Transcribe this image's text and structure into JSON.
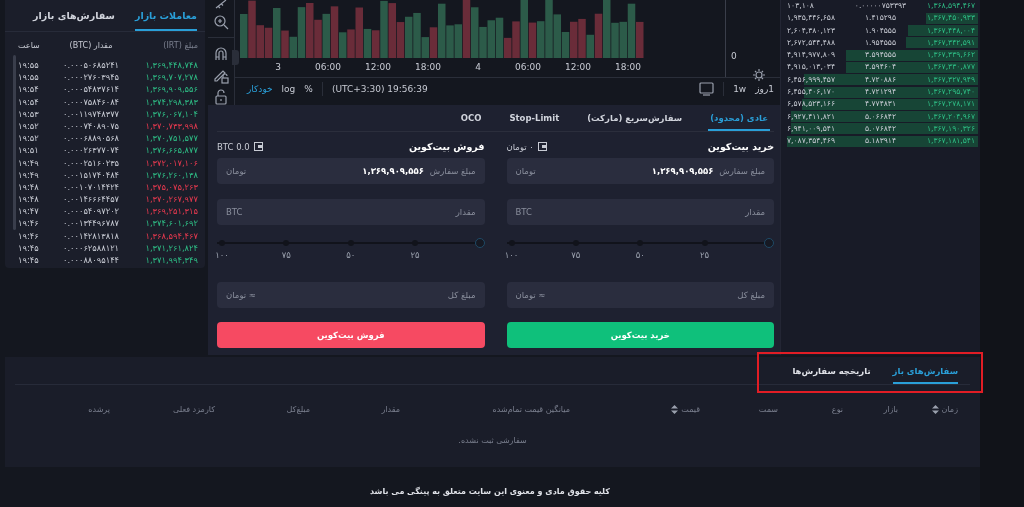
{
  "market_trades": {
    "tabs": [
      {
        "label": "معاملات بازار",
        "selected": true
      },
      {
        "label": "سفارش‌های بازار",
        "selected": false
      }
    ],
    "columns": [
      "مبلغ (IRT)",
      "مقدار (BTC)",
      "ساعت"
    ],
    "rows": [
      {
        "price": "۱,۳۶۹,۴۴۸,۷۴۸",
        "amount": "۰.۰۰۰۵۰۶۸۵۲۴۱",
        "time": "۱۹:۵۵",
        "kind": "buy"
      },
      {
        "price": "۱,۳۶۹,۷۰۷,۲۷۸",
        "amount": "۰.۰۰۰۲۷۶۰۳۹۴۵",
        "time": "۱۹:۵۵",
        "kind": "buy"
      },
      {
        "price": "۱,۳۶۹,۹۰۹,۵۵۶",
        "amount": "۰.۰۰۰۵۴۸۳۷۶۱۴",
        "time": "۱۹:۵۴",
        "kind": "buy"
      },
      {
        "price": "۱,۳۷۴,۲۹۸,۳۸۳",
        "amount": "۰.۰۰۰۷۵۸۴۶۰۸۴",
        "time": "۱۹:۵۴",
        "kind": "buy"
      },
      {
        "price": "۱,۳۷۶,۰۶۷,۱۰۴",
        "amount": "۰.۰۰۱۱۹۷۴۸۳۷۷",
        "time": "۱۹:۵۳",
        "kind": "buy"
      },
      {
        "price": "۱,۳۷۰,۷۳۳,۹۹۸",
        "amount": "۰.۰۰۰۷۴۰۸۹۰۷۵",
        "time": "۱۹:۵۲",
        "kind": "sell"
      },
      {
        "price": "۱,۳۷۰,۷۵۱,۵۷۷",
        "amount": "۰.۰۰۰۶۸۸۹۰۵۶۸",
        "time": "۱۹:۵۲",
        "kind": "buy"
      },
      {
        "price": "۱,۳۷۶,۶۶۵,۸۷۷",
        "amount": "۰.۰۰۰۲۶۳۷۷۰۷۴",
        "time": "۱۹:۵۱",
        "kind": "buy"
      },
      {
        "price": "۱,۳۷۲,۰۱۷,۱۰۶",
        "amount": "۰.۰۰۰۲۵۱۶۰۲۳۵",
        "time": "۱۹:۴۹",
        "kind": "sell"
      },
      {
        "price": "۱,۳۷۶,۲۶۰,۱۳۸",
        "amount": "۰.۰۰۱۵۱۷۴۰۴۸۴",
        "time": "۱۹:۴۹",
        "kind": "buy"
      },
      {
        "price": "۱,۳۷۵,۰۷۵,۲۶۳",
        "amount": "۰.۰۰۱۰۷۰۱۴۴۲۴",
        "time": "۱۹:۴۸",
        "kind": "sell"
      },
      {
        "price": "۱,۳۷۰,۲۶۷,۹۷۷",
        "amount": "۰.۰۰۱۴۶۶۶۴۴۵۷",
        "time": "۱۹:۴۸",
        "kind": "sell"
      },
      {
        "price": "۱,۳۶۹,۲۵۱,۳۱۵",
        "amount": "۰.۰۰۰۵۴۰۹۷۲۰۲",
        "time": "۱۹:۴۷",
        "kind": "sell"
      },
      {
        "price": "۱,۳۷۴,۶۰۱,۶۹۲",
        "amount": "۰.۰۰۱۳۴۴۹۶۷۸۷",
        "time": "۱۹:۴۶",
        "kind": "buy"
      },
      {
        "price": "۱,۳۶۸,۵۹۴,۴۶۷",
        "amount": "۰.۰۰۱۴۲۸۱۳۸۱۸",
        "time": "۱۹:۴۶",
        "kind": "sell"
      },
      {
        "price": "۱,۳۷۱,۲۶۱,۸۲۴",
        "amount": "۰.۰۰۰۶۲۵۸۸۱۲۱",
        "time": "۱۹:۴۵",
        "kind": "buy"
      },
      {
        "price": "۱,۳۷۱,۹۹۴,۳۴۹",
        "amount": "۰.۰۰۰۸۸۰۹۵۱۴۴",
        "time": "۱۹:۴۵",
        "kind": "buy"
      }
    ]
  },
  "chart": {
    "time_labels": [
      "18:00",
      "12:00",
      "06:00",
      "4",
      "18:00",
      "12:00",
      "06:00",
      "3"
    ],
    "axis_label": "0",
    "toolbar": {
      "auto": "خودکار",
      "log": "log",
      "percent": "%",
      "clock": "(UTC+3:30) 19:56:39",
      "intervals": [
        "1روز",
        "1w"
      ]
    }
  },
  "order_form": {
    "tabs": [
      {
        "label": "عادی (محدود)",
        "selected": true
      },
      {
        "label": "سفارش‌سریع (مارکت)",
        "selected": false
      },
      {
        "label": "Stop-Limit",
        "selected": false
      },
      {
        "label": "OCO",
        "selected": false
      }
    ],
    "panels": [
      {
        "kind": "buy",
        "title": "خرید بیت‌کوین",
        "balance": "۰ تومان",
        "price_label": "مبلغ سفارش",
        "price": "۱,۳۶۹,۹۰۹,۵۵۶",
        "price_unit": "تومان",
        "amount_placeholder": "مقدار",
        "amount_unit": "BTC",
        "slider_labels": [
          "۲۵",
          "۵۰",
          "۷۵",
          "۱۰۰"
        ],
        "total_placeholder": "مبلغ کل",
        "total_unit": "≈ تومان",
        "button": "خرید بیت‌کوین"
      },
      {
        "kind": "sell",
        "title": "فروش بیت‌کوین",
        "balance": "BTC 0.0",
        "price_label": "مبلغ سفارش",
        "price": "۱,۳۶۹,۹۰۹,۵۵۶",
        "price_unit": "تومان",
        "amount_placeholder": "مقدار",
        "amount_unit": "BTC",
        "slider_labels": [
          "۲۵",
          "۵۰",
          "۷۵",
          "۱۰۰"
        ],
        "total_placeholder": "مبلغ کل",
        "total_unit": "≈ تومان",
        "button": "فروش بیت‌کوین"
      }
    ]
  },
  "order_book": {
    "rows": [
      {
        "total": "۱۰۳,۱۰۸",
        "amount": "۰.۰۰۰۰۰۷۵۳۳۹۳",
        "price": "۱,۳۶۸,۵۹۴,۴۶۷"
      },
      {
        "total": "۱,۹۳۵,۴۴۶,۶۵۸",
        "amount": "۱.۴۱۵۲۹۵",
        "price": "۱,۳۶۷,۴۵۰,۹۳۳"
      },
      {
        "total": "۲,۶۰۴,۳۸۰,۱۲۳",
        "amount": "۱.۹۰۴۵۵۵",
        "price": "۱,۳۶۷,۴۴۸,۰۰۴"
      },
      {
        "total": "۲,۶۷۲,۵۴۴,۴۸۸",
        "amount": "۱.۹۵۴۵۵۵",
        "price": "۱,۳۶۷,۳۴۲,۵۹۱"
      },
      {
        "total": "۴,۹۱۴,۹۷۷,۸۰۹",
        "amount": "۳.۵۹۴۵۵۵",
        "price": "۱,۳۶۷,۳۳۹,۶۶۲"
      },
      {
        "total": "۴,۹۱۵,۰۱۳,۰۳۴",
        "amount": "۳.۵۹۴۶۰۴",
        "price": "۱,۳۶۷,۳۳۰,۸۷۷"
      },
      {
        "total": "۶,۴۵۶,۹۹۹,۴۵۷",
        "amount": "۴.۷۲۰۸۸۶",
        "price": "۱,۳۶۷,۳۲۷,۹۴۹"
      },
      {
        "total": "۶,۴۵۵,۴۰۶,۱۷۰",
        "amount": "۴.۷۲۱۲۹۴",
        "price": "۱,۳۶۷,۲۹۵,۷۴۰"
      },
      {
        "total": "۶,۵۷۸,۵۲۳,۱۶۶",
        "amount": "۴.۷۷۴۸۳۱",
        "price": "۱,۳۶۷,۲۷۸,۱۷۱"
      },
      {
        "total": "۶,۹۲۷,۴۱۱,۸۲۱",
        "amount": "۵.۰۶۶۸۴۲",
        "price": "۱,۳۶۷,۲۰۴,۹۶۷"
      },
      {
        "total": "۶,۹۴۱,۰۰۹,۵۴۱",
        "amount": "۵.۰۷۶۸۴۲",
        "price": "۱,۳۶۷,۱۹۰,۳۲۶"
      },
      {
        "total": "۷,۰۸۷,۳۵۴,۴۶۹",
        "amount": "۵.۱۸۳۹۱۴",
        "price": "۱,۳۶۷,۱۸۱,۵۴۱"
      }
    ]
  },
  "orders": {
    "highlighted": true,
    "tabs": [
      {
        "label": "سفارش‌های باز",
        "selected": true
      },
      {
        "label": "تاریخچه سفارش‌ها",
        "selected": false
      }
    ],
    "columns": [
      {
        "label": "زمان",
        "sortable": true
      },
      {
        "label": "بازار",
        "sortable": false
      },
      {
        "label": "نوع",
        "sortable": false
      },
      {
        "label": "سمت",
        "sortable": false
      },
      {
        "label": "قیمت",
        "sortable": true
      },
      {
        "label": "میانگین قیمت تمام‌شده",
        "sortable": false
      },
      {
        "label": "مقدار",
        "sortable": false
      },
      {
        "label": "مبلغ‌کل",
        "sortable": false
      },
      {
        "label": "کارمزد فعلی",
        "sortable": false
      },
      {
        "label": "پرشده",
        "sortable": false
      }
    ],
    "empty_message": "سفارشی ثبت نشده."
  },
  "footer": "کلیه حقوق مادی و معنوی این سایت متعلق به پینگی می باشد"
}
